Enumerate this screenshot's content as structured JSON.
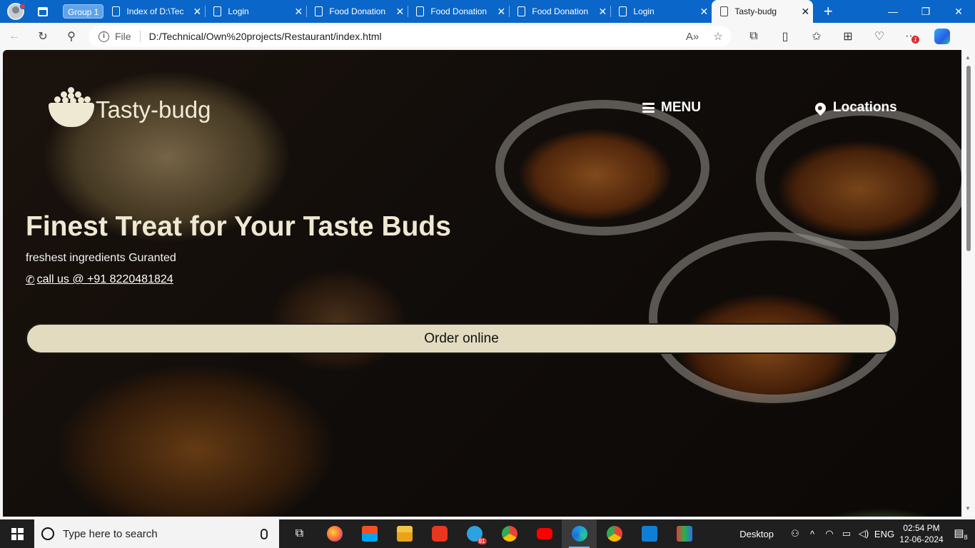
{
  "browser": {
    "group_label": "Group 1",
    "tabs": [
      {
        "label": "Index of D:\\Tec",
        "active": false
      },
      {
        "label": "Login",
        "active": false
      },
      {
        "label": "Food Donation",
        "active": false
      },
      {
        "label": "Food Donation",
        "active": false
      },
      {
        "label": "Food Donation",
        "active": false
      },
      {
        "label": "Login",
        "active": false
      },
      {
        "label": "Tasty-budg",
        "active": true
      }
    ],
    "address": {
      "scheme_label": "File",
      "url": "D:/Technical/Own%20projects/Restaurant/index.html"
    },
    "extension_badge": "1"
  },
  "page": {
    "brand": "Tasty-budg",
    "nav": {
      "menu_label": "MENU",
      "locations_label": "Locations"
    },
    "hero": {
      "headline": "Finest Treat for Your Taste Buds",
      "tagline": "freshest ingredients Guranted",
      "call_text": " call us @ +91 8220481824"
    },
    "order_button": "Order online"
  },
  "taskbar": {
    "search_placeholder": "Type here to search",
    "telegram_badge": "91",
    "desktop_label": "Desktop",
    "language": "ENG",
    "time": "02:54 PM",
    "date": "12-06-2024",
    "notification_count": "8"
  },
  "colors": {
    "browser_accent": "#0a66c8",
    "brand_cream": "#efe8d2",
    "order_button_bg": "#e3dbc0"
  }
}
